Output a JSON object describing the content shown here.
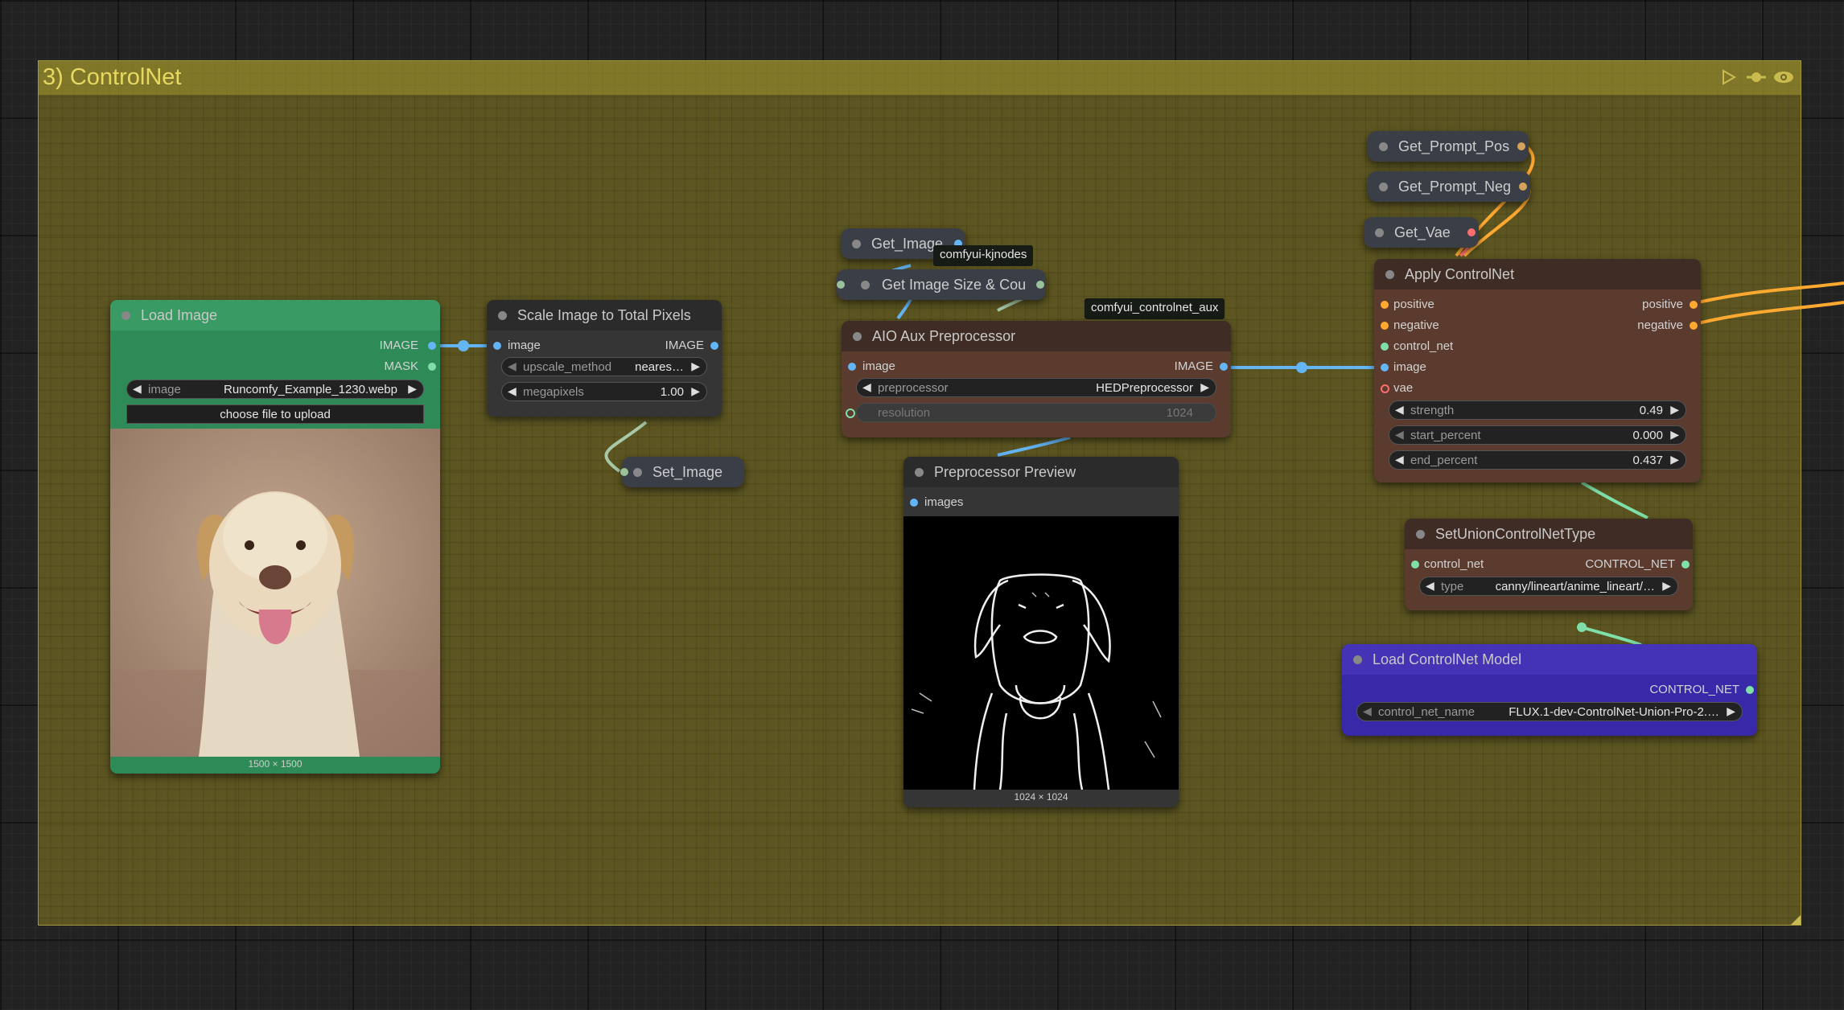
{
  "group": {
    "title": "3) ControlNet"
  },
  "colors": {
    "load_image_bg": "#2e8b57",
    "controlnet_model_bg": "#3729a8",
    "apply_controlnet_bg": "#5a3b2e",
    "link_image": "#64b5f6",
    "link_conditioning": "#ffa931",
    "link_controlnet": "#7ee0a8"
  },
  "load_image": {
    "title": "Load Image",
    "outputs": [
      "IMAGE",
      "MASK"
    ],
    "image_widget": {
      "label": "image",
      "value": "Runcomfy_Example_1230.webp"
    },
    "upload_button": "choose file to upload",
    "dimensions": "1500 × 1500"
  },
  "scale_image": {
    "title": "Scale Image to Total Pixels",
    "input": "image",
    "output": "IMAGE",
    "upscale_method": {
      "label": "upscale_method",
      "value": "neares…"
    },
    "megapixels": {
      "label": "megapixels",
      "value": "1.00"
    }
  },
  "set_image": {
    "title": "Set_Image"
  },
  "get_image": {
    "title": "Get_Image"
  },
  "get_image_size": {
    "title": "Get Image Size & Cou"
  },
  "badges": {
    "kjnodes": "comfyui-kjnodes",
    "controlnet_aux": "comfyui_controlnet_aux"
  },
  "aio_aux": {
    "title": "AIO Aux Preprocessor",
    "input": "image",
    "output": "IMAGE",
    "preprocessor": {
      "label": "preprocessor",
      "value": "HEDPreprocessor"
    },
    "resolution": {
      "label": "resolution",
      "value": "1024"
    }
  },
  "preview": {
    "title": "Preprocessor Preview",
    "input": "images",
    "dimensions": "1024 × 1024"
  },
  "get_prompt_pos": {
    "title": "Get_Prompt_Pos"
  },
  "get_prompt_neg": {
    "title": "Get_Prompt_Neg"
  },
  "get_vae": {
    "title": "Get_Vae"
  },
  "apply_controlnet": {
    "title": "Apply ControlNet",
    "inputs": [
      "positive",
      "negative",
      "control_net",
      "image",
      "vae"
    ],
    "outputs": [
      "positive",
      "negative"
    ],
    "strength": {
      "label": "strength",
      "value": "0.49"
    },
    "start_percent": {
      "label": "start_percent",
      "value": "0.000"
    },
    "end_percent": {
      "label": "end_percent",
      "value": "0.437"
    }
  },
  "union_type": {
    "title": "SetUnionControlNetType",
    "input": "control_net",
    "output": "CONTROL_NET",
    "type": {
      "label": "type",
      "value": "canny/lineart/anime_lineart/…"
    }
  },
  "load_controlnet": {
    "title": "Load ControlNet Model",
    "output": "CONTROL_NET",
    "control_net_name": {
      "label": "control_net_name",
      "value": "FLUX.1-dev-ControlNet-Union-Pro-2.…"
    }
  }
}
